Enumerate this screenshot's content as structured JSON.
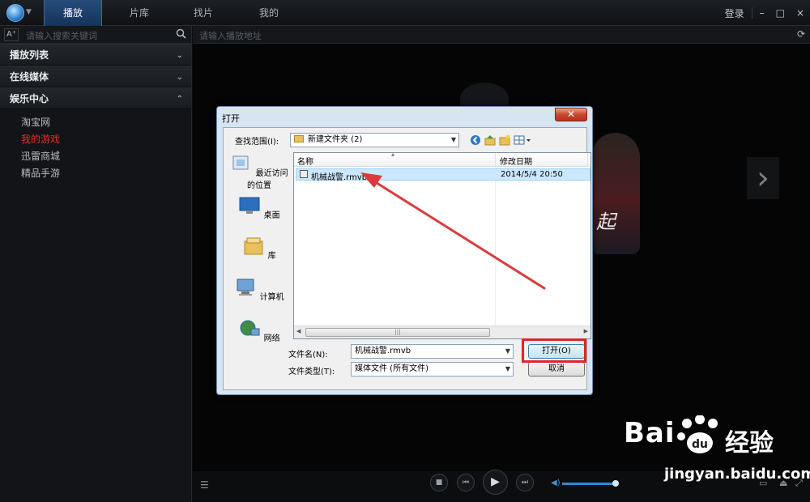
{
  "topbar": {
    "tabs": [
      "播放",
      "片库",
      "找片",
      "我的"
    ],
    "login": "登录",
    "minimize": "–",
    "maximize": "□",
    "close": "×"
  },
  "sidebar": {
    "font_button": "A⁺",
    "search_placeholder": "请输入搜索关键词",
    "sections": [
      {
        "label": "播放列表",
        "chevron": "⌄"
      },
      {
        "label": "在线媒体",
        "chevron": "⌄"
      },
      {
        "label": "娱乐中心",
        "chevron": "⌃"
      }
    ],
    "items": [
      {
        "label": "淘宝网",
        "color": "#b9bdc2"
      },
      {
        "label": "我的游戏",
        "color": "#e0322b"
      },
      {
        "label": "迅雷商城",
        "color": "#b9bdc2"
      },
      {
        "label": "精品手游",
        "color": "#b9bdc2"
      }
    ],
    "list_icon": "☰"
  },
  "address_bar": {
    "placeholder": "请输入播放地址",
    "refresh_icon": "refresh-icon"
  },
  "video": {
    "overlay_char": "起",
    "next_arrow": "›"
  },
  "dialog": {
    "title": "打开",
    "close_icon": "✕",
    "lookin_label": "查找范围(I):",
    "lookin_value": "新建文件夹 (2)",
    "places": [
      "最近访问的位置",
      "桌面",
      "库",
      "计算机",
      "网络"
    ],
    "columns": [
      "名称",
      "修改日期"
    ],
    "files": [
      {
        "name": "机械战警.rmvb",
        "modified": "2014/5/4 20:50"
      }
    ],
    "filename_label": "文件名(N):",
    "filename_value": "机械战警.rmvb",
    "filetype_label": "文件类型(T):",
    "filetype_value": "媒体文件 (所有文件)",
    "open_button": "打开(O)",
    "cancel_button": "取消"
  },
  "watermark": {
    "brand": "Bai",
    "brand_suffix": "经验",
    "url": "jingyan.baidu.com"
  },
  "colors": {
    "accent_blue": "#2b8bd6",
    "highlight_red": "#e0242a",
    "active_tab": "#274c7a"
  }
}
